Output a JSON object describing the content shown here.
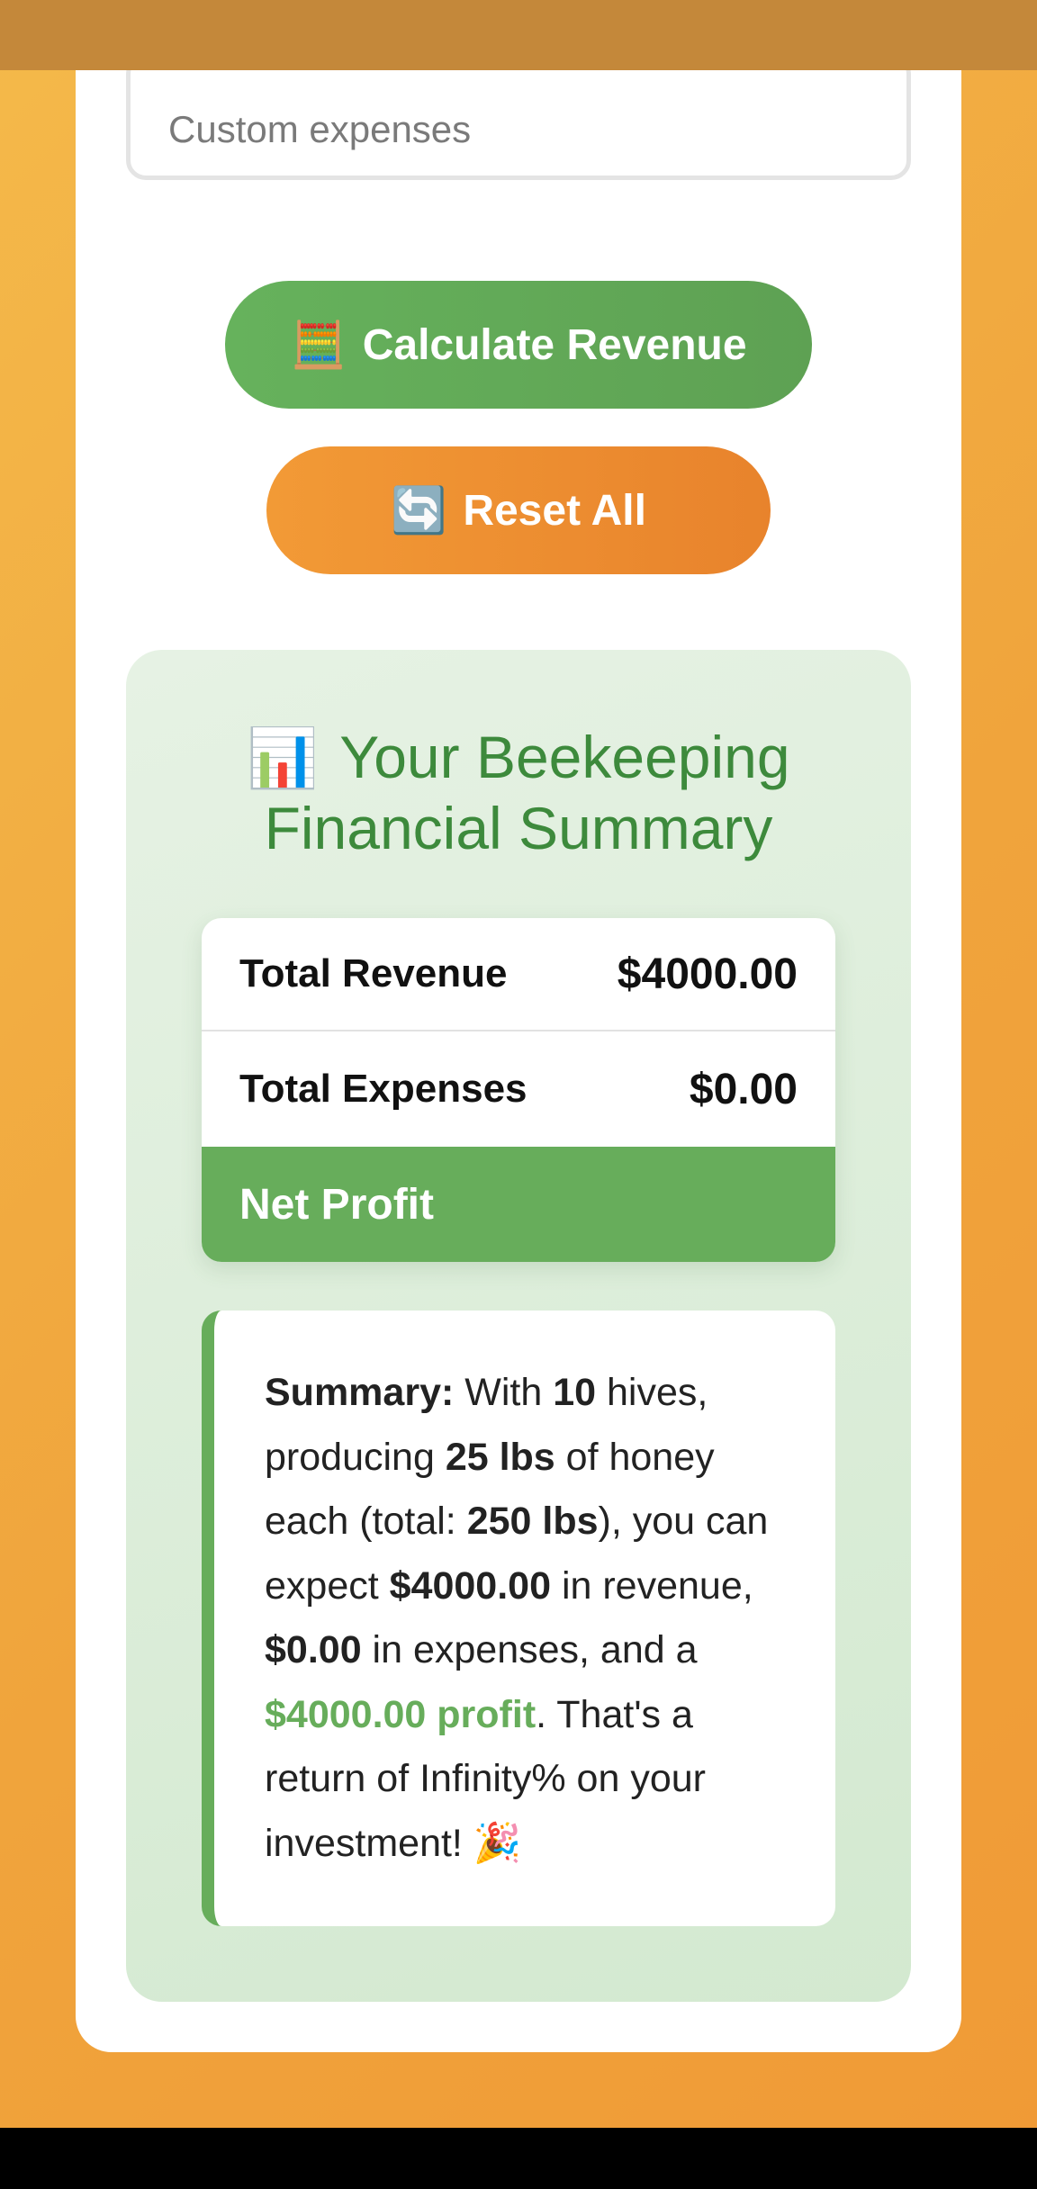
{
  "form": {
    "custom_expenses_placeholder": "Custom expenses"
  },
  "buttons": {
    "calculate_icon": "🧮",
    "calculate_label": "Calculate Revenue",
    "reset_icon": "🔄",
    "reset_label": "Reset All"
  },
  "results": {
    "title_icon": "📊",
    "title": "Your Beekeeping Financial Summary",
    "rows": {
      "revenue_label": "Total Revenue",
      "revenue_value": "$4000.00",
      "expenses_label": "Total Expenses",
      "expenses_value": "$0.00",
      "net_label": "Net Profit",
      "net_value": ""
    },
    "summary": {
      "lead": "Summary:",
      "t1": " With ",
      "hives": "10",
      "t2": " hives, producing ",
      "lbs_per_hive": "25 lbs",
      "t3": " of honey each (total: ",
      "total_lbs": "250 lbs",
      "t4": "), you can expect ",
      "revenue": "$4000.00",
      "t5": " in revenue, ",
      "expenses": "$0.00",
      "t6": " in expenses, and a ",
      "profit": "$4000.00 profit",
      "t7": ". That's a return of Infinity% on your investment! ",
      "celebrate_icon": "🎉"
    }
  },
  "colors": {
    "background": "#f0a43c",
    "top_bar": "#c4883a",
    "calculate_button": "#63aa58",
    "reset_button": "#ee8f31",
    "accent_green": "#67ad5b",
    "title_green": "#3d8a3c"
  }
}
